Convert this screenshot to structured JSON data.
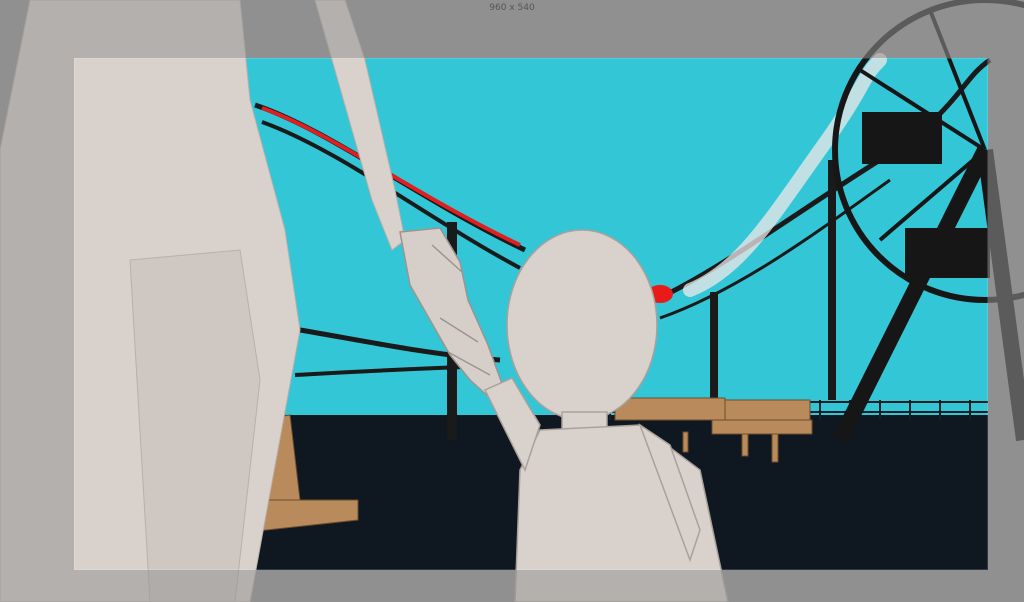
{
  "viewport": {
    "resolution_label": "960 x 540"
  },
  "colors": {
    "sky": "#33c6d6",
    "ground": "#0f1720",
    "track": "#1a1a1a",
    "track_highlight": "#e02020",
    "figure": "#d9d1cb",
    "figure_shadow": "#bdb4ad",
    "bench_wood": "#b98a5c",
    "overlay": "rgba(150,150,150,0.55)"
  }
}
